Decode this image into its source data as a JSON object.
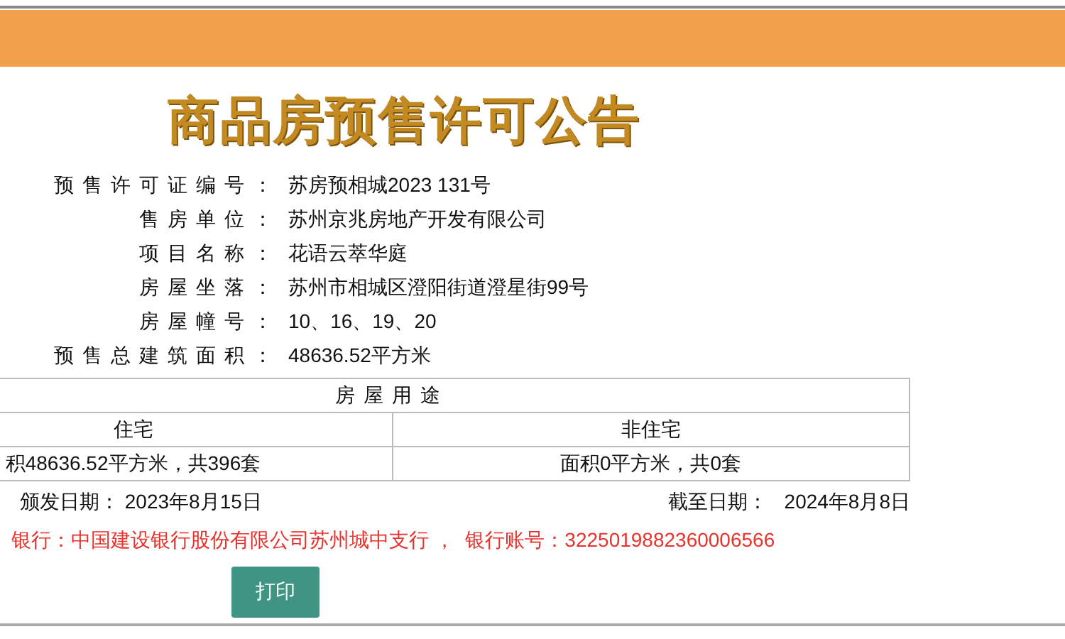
{
  "title": "商品房预售许可公告",
  "fields": [
    {
      "label": "预售许可证编号：",
      "value": "苏房预相城2023 131号"
    },
    {
      "label": "售房单位：",
      "value": "苏州京兆房地产开发有限公司"
    },
    {
      "label": "项目名称：",
      "value": "花语云萃华庭"
    },
    {
      "label": "房屋坐落：",
      "value": "苏州市相城区澄阳街道澄星街99号"
    },
    {
      "label": "房屋幢号：",
      "value": "10、16、19、20"
    },
    {
      "label": "预售总建筑面积：",
      "value": "48636.52平方米"
    }
  ],
  "usage_table": {
    "heading": "房屋用途",
    "columns": [
      "住宅",
      "非住宅"
    ],
    "cells": [
      "积48636.52平方米，共396套",
      "面积0平方米，共0套"
    ]
  },
  "issue_date": {
    "label": "颁发日期：",
    "value": "2023年8月15日"
  },
  "expiry_date": {
    "label": "截至日期：",
    "value": "2024年8月8日"
  },
  "bank_info": "银行：中国建设银行股份有限公司苏州城中支行 ，  银行账号：3225019882360006566",
  "buttons": [
    "打印"
  ]
}
